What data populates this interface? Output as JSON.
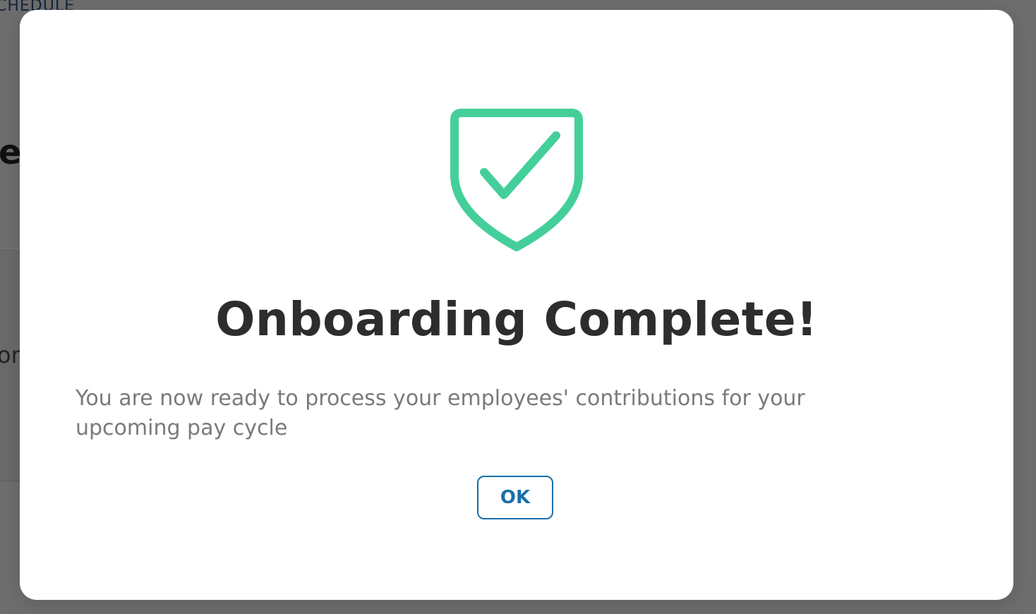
{
  "background": {
    "schedule_label": "CHEDULE",
    "heading_fragment": "e",
    "para_fragment": "on"
  },
  "modal": {
    "icon": "shield-check-icon",
    "icon_color": "#44CF9A",
    "title": "Onboarding Complete!",
    "message": "You are now ready to process your employees' contributions for your upcoming pay cycle",
    "ok_label": "OK",
    "button_color": "#1A6FA8"
  }
}
